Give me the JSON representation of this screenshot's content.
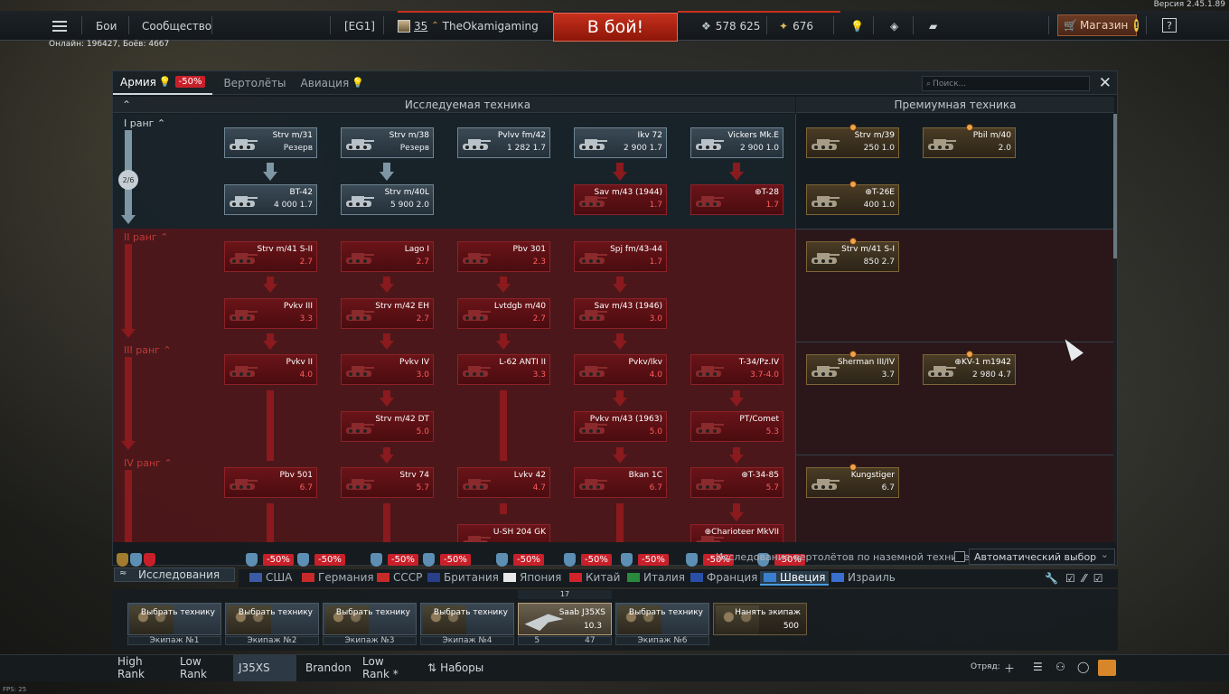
{
  "version": "Версия 2.45.1.89",
  "top": {
    "menu_battles": "Бои",
    "menu_community": "Сообщество",
    "clan_tag": "[EG1]",
    "player_level": "35",
    "player_name": "TheOkamigaming",
    "battle_button": "В бой!",
    "silver_lions": "578 625",
    "gold_eagles": "676",
    "shop": "Магазин",
    "help": "?"
  },
  "online": "Онлайн: 196427, Боёв: 4667",
  "panel": {
    "tabs": [
      {
        "label": "Армия",
        "discount": "-50%"
      },
      {
        "label": "Вертолёты"
      },
      {
        "label": "Авиация"
      }
    ],
    "search_placeholder": "Поиск...",
    "close": "✕",
    "researched_header": "Исследуемая техника",
    "premium_header": "Премиумная техника",
    "rank_labels": [
      "I ранг",
      "II ранг",
      "III ранг",
      "IV ранг"
    ],
    "rank_progress": "2/6"
  },
  "vehicles": {
    "r1": [
      {
        "name": "Strv m/31",
        "stat": "Резерв"
      },
      {
        "name": "Strv m/38",
        "stat": "Резерв"
      },
      {
        "name": "Pvlvv fm/42",
        "stat": "1 282 1.7"
      },
      {
        "name": "Ikv 72",
        "stat": "2 900 1.7"
      },
      {
        "name": "Vickers Mk.E",
        "stat": "2 900 1.0"
      },
      {
        "name": "BT-42",
        "stat": "4 000 1.7"
      },
      {
        "name": "Strv m/40L",
        "stat": "5 900 2.0"
      },
      {
        "name": "Sav m/43 (1944)",
        "stat": "1.7"
      },
      {
        "name": "⊕T-28",
        "stat": "1.7"
      }
    ],
    "r2": [
      {
        "name": "Strv m/41 S-II",
        "stat": "2.7"
      },
      {
        "name": "Lago I",
        "stat": "2.7"
      },
      {
        "name": "Pbv 301",
        "stat": "2.3"
      },
      {
        "name": "Spj fm/43-44",
        "stat": "1.7"
      },
      {
        "name": "Pvkv III",
        "stat": "3.3"
      },
      {
        "name": "Strv m/42 EH",
        "stat": "2.7"
      },
      {
        "name": "Lvtdgb m/40",
        "stat": "2.7"
      },
      {
        "name": "Sav m/43 (1946)",
        "stat": "3.0"
      }
    ],
    "r3": [
      {
        "name": "Pvkv II",
        "stat": "4.0"
      },
      {
        "name": "Pvkv IV",
        "stat": "3.0"
      },
      {
        "name": "L-62 ANTI II",
        "stat": "3.3"
      },
      {
        "name": "Pvkv/Ikv",
        "stat": "4.0"
      },
      {
        "name": "T-34/Pz.IV",
        "stat": "3.7-4.0"
      },
      {
        "name": "Strv m/42 DT",
        "stat": "5.0"
      },
      {
        "name": "Pvkv m/43 (1963)",
        "stat": "5.0"
      },
      {
        "name": "PT/Comet",
        "stat": "5.3"
      }
    ],
    "r4": [
      {
        "name": "Pbv 501",
        "stat": "6.7"
      },
      {
        "name": "Strv 74",
        "stat": "5.7"
      },
      {
        "name": "Lvkv 42",
        "stat": "4.7"
      },
      {
        "name": "Bkan 1C",
        "stat": "6.7"
      },
      {
        "name": "⊕T-34-85",
        "stat": "5.7"
      },
      {
        "name": "U-SH 204 GK",
        "stat": ""
      },
      {
        "name": "⊕Charioteer MkVII",
        "stat": ""
      }
    ],
    "premium": [
      {
        "name": "Strv m/39",
        "stat": "250 1.0"
      },
      {
        "name": "Pbil m/40",
        "stat": "2.0"
      },
      {
        "name": "⊕T-26E",
        "stat": "400 1.0"
      },
      {
        "name": "Strv m/41 S-I",
        "stat": "850 2.7"
      },
      {
        "name": "Sherman III/IV",
        "stat": "3.7"
      },
      {
        "name": "⊕KV-1 m1942",
        "stat": "2 980 4.7"
      },
      {
        "name": "Kungstiger",
        "stat": "6.7"
      }
    ]
  },
  "research_label": "Исследования",
  "discounts": [
    "-50%",
    "-50%",
    "-50%",
    "-50%",
    "-50%",
    "-50%",
    "-50%",
    "-50%",
    "-50%"
  ],
  "nations": [
    "США",
    "Германия",
    "СССР",
    "Британия",
    "Япония",
    "Китай",
    "Италия",
    "Франция",
    "Швеция",
    "Израиль"
  ],
  "active_nation": "Швеция",
  "auto_label": "Исследование вертолётов по наземной технике",
  "auto_select": "Автоматический выбор",
  "crew": [
    {
      "label": "Выбрать технику",
      "foot": "Экипаж №1"
    },
    {
      "label": "Выбрать технику",
      "foot": "Экипаж №2"
    },
    {
      "label": "Выбрать технику",
      "foot": "Экипаж №3"
    },
    {
      "label": "Выбрать технику",
      "foot": "Экипаж №4"
    },
    {
      "label": "Saab J35XS",
      "foot": "5",
      "br": "10.3",
      "top": "17",
      "extra": "47"
    },
    {
      "label": "Выбрать технику",
      "foot": "Экипаж №6"
    },
    {
      "label": "Нанять экипаж",
      "cost": "500"
    }
  ],
  "bottom_tabs": [
    "High Rank",
    "Low Rank",
    "J35XS",
    "Brandon",
    "Low Rank *",
    "Наборы"
  ],
  "squad": "Отряд:",
  "fps": "FPS: 25",
  "colors": {
    "accent_red": "#c7301c",
    "locked": "#6a1418",
    "premium": "#7e6437",
    "active_nation": "#4a9be0"
  }
}
